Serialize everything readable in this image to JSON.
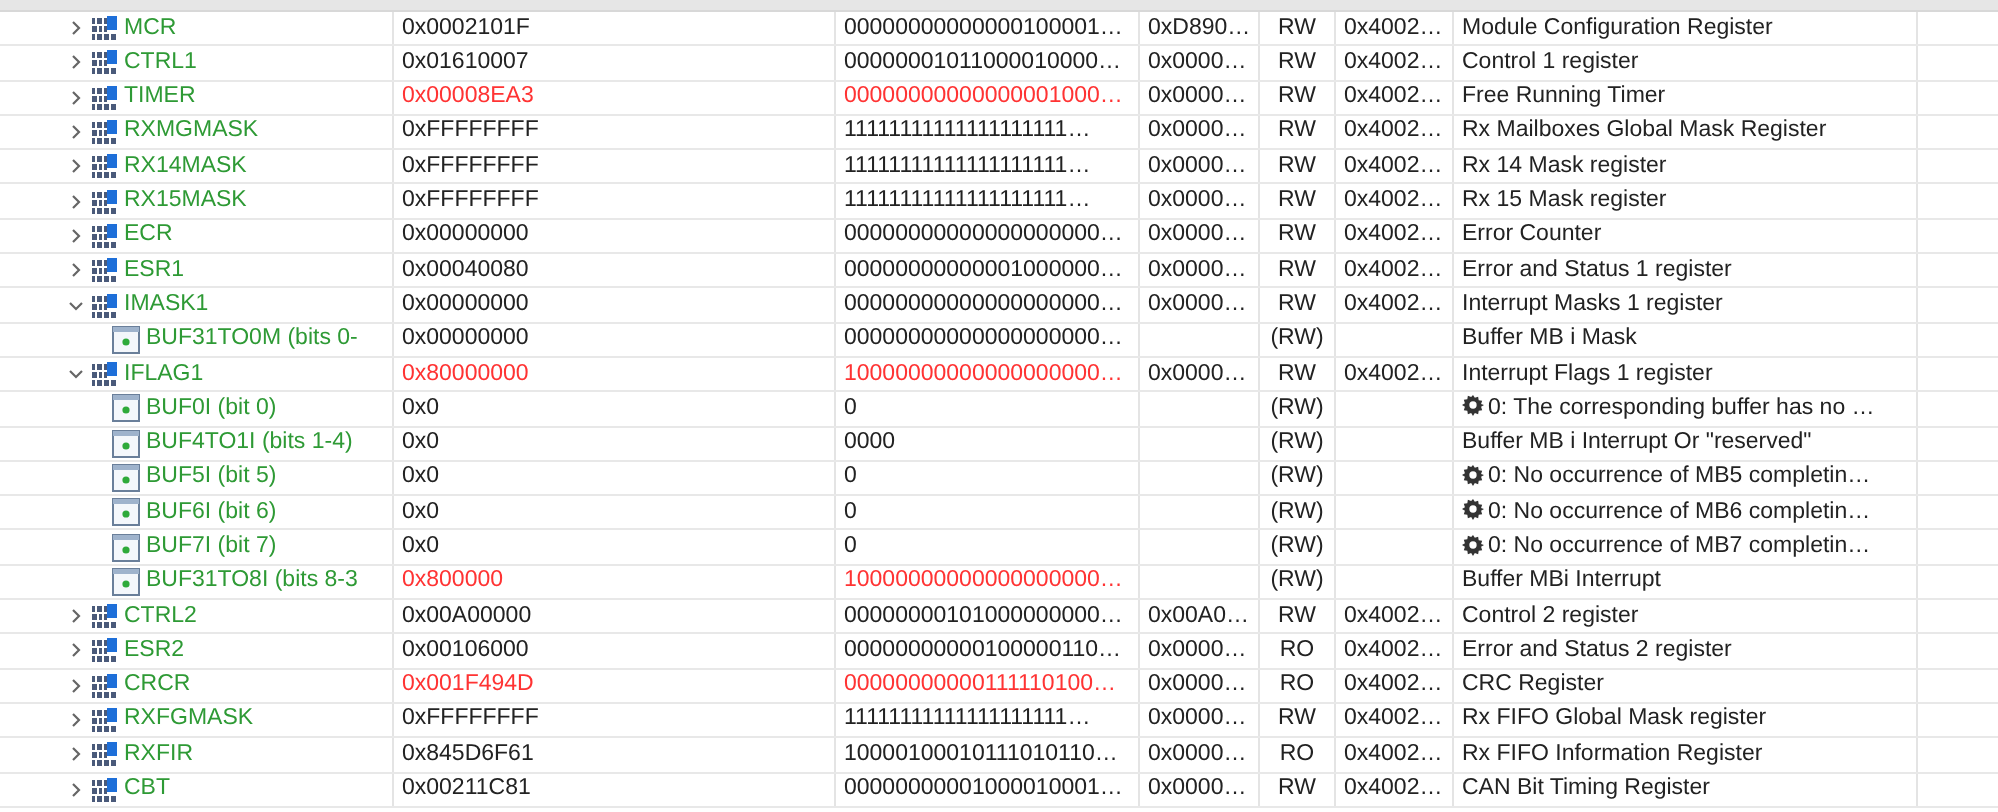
{
  "rows": [
    {
      "name": "MCR",
      "expanded": false,
      "value": "0x0002101F",
      "changed": false,
      "bits": "00000000000000100001…",
      "hex": "0xD890…",
      "access": "RW",
      "address": "0x4002…",
      "description": "Module Configuration Register"
    },
    {
      "name": "CTRL1",
      "expanded": false,
      "value": "0x01610007",
      "changed": false,
      "bits": "00000001011000010000…",
      "hex": "0x0000…",
      "access": "RW",
      "address": "0x4002…",
      "description": "Control 1 register"
    },
    {
      "name": "TIMER",
      "expanded": false,
      "value": "0x00008EA3",
      "changed": true,
      "bits": "00000000000000001000…",
      "hex": "0x0000…",
      "access": "RW",
      "address": "0x4002…",
      "description": "Free Running Timer"
    },
    {
      "name": "RXMGMASK",
      "expanded": false,
      "value": "0xFFFFFFFF",
      "changed": false,
      "bits": "11111111111111111111…",
      "hex": "0x0000…",
      "access": "RW",
      "address": "0x4002…",
      "description": "Rx Mailboxes Global Mask Register"
    },
    {
      "name": "RX14MASK",
      "expanded": false,
      "value": "0xFFFFFFFF",
      "changed": false,
      "bits": "11111111111111111111…",
      "hex": "0x0000…",
      "access": "RW",
      "address": "0x4002…",
      "description": "Rx 14 Mask register"
    },
    {
      "name": "RX15MASK",
      "expanded": false,
      "value": "0xFFFFFFFF",
      "changed": false,
      "bits": "11111111111111111111…",
      "hex": "0x0000…",
      "access": "RW",
      "address": "0x4002…",
      "description": "Rx 15 Mask register"
    },
    {
      "name": "ECR",
      "expanded": false,
      "value": "0x00000000",
      "changed": false,
      "bits": "00000000000000000000…",
      "hex": "0x0000…",
      "access": "RW",
      "address": "0x4002…",
      "description": "Error Counter"
    },
    {
      "name": "ESR1",
      "expanded": false,
      "value": "0x00040080",
      "changed": false,
      "bits": "00000000000001000000…",
      "hex": "0x0000…",
      "access": "RW",
      "address": "0x4002…",
      "description": "Error and Status 1 register"
    },
    {
      "name": "IMASK1",
      "expanded": true,
      "value": "0x00000000",
      "changed": false,
      "bits": "00000000000000000000…",
      "hex": "0x0000…",
      "access": "RW",
      "address": "0x4002…",
      "description": "Interrupt Masks 1 register",
      "children": [
        {
          "name": "BUF31TO0M (bits 0-",
          "value": "0x00000000",
          "changed": false,
          "bits": "00000000000000000000…",
          "access": "(RW)",
          "description": "Buffer MB i Mask",
          "note_icon": false
        }
      ]
    },
    {
      "name": "IFLAG1",
      "expanded": true,
      "value": "0x80000000",
      "changed": true,
      "bits": "10000000000000000000…",
      "hex": "0x0000…",
      "access": "RW",
      "address": "0x4002…",
      "description": "Interrupt Flags 1 register",
      "children": [
        {
          "name": "BUF0I (bit 0)",
          "value": "0x0",
          "changed": false,
          "bits": "0",
          "access": "(RW)",
          "description": "0: The corresponding buffer has no …",
          "note_icon": true
        },
        {
          "name": "BUF4TO1I (bits 1-4)",
          "value": "0x0",
          "changed": false,
          "bits": "0000",
          "access": "(RW)",
          "description": "Buffer MB i Interrupt Or \"reserved\"",
          "note_icon": false
        },
        {
          "name": "BUF5I (bit 5)",
          "value": "0x0",
          "changed": false,
          "bits": "0",
          "access": "(RW)",
          "description": "0: No occurrence of MB5 completin…",
          "note_icon": true
        },
        {
          "name": "BUF6I (bit 6)",
          "value": "0x0",
          "changed": false,
          "bits": "0",
          "access": "(RW)",
          "description": "0: No occurrence of MB6 completin…",
          "note_icon": true
        },
        {
          "name": "BUF7I (bit 7)",
          "value": "0x0",
          "changed": false,
          "bits": "0",
          "access": "(RW)",
          "description": "0: No occurrence of MB7 completin…",
          "note_icon": true
        },
        {
          "name": "BUF31TO8I (bits 8-3",
          "value": "0x800000",
          "changed": true,
          "bits": "10000000000000000000…",
          "access": "(RW)",
          "description": "Buffer MBi Interrupt",
          "note_icon": false
        }
      ]
    },
    {
      "name": "CTRL2",
      "expanded": false,
      "value": "0x00A00000",
      "changed": false,
      "bits": "00000000101000000000…",
      "hex": "0x00A0…",
      "access": "RW",
      "address": "0x4002…",
      "description": "Control 2 register"
    },
    {
      "name": "ESR2",
      "expanded": false,
      "value": "0x00106000",
      "changed": false,
      "bits": "00000000000100000110…",
      "hex": "0x0000…",
      "access": "RO",
      "address": "0x4002…",
      "description": "Error and Status 2 register"
    },
    {
      "name": "CRCR",
      "expanded": false,
      "value": "0x001F494D",
      "changed": true,
      "bits": "00000000000111110100…",
      "hex": "0x0000…",
      "access": "RO",
      "address": "0x4002…",
      "description": "CRC Register"
    },
    {
      "name": "RXFGMASK",
      "expanded": false,
      "value": "0xFFFFFFFF",
      "changed": false,
      "bits": "11111111111111111111…",
      "hex": "0x0000…",
      "access": "RW",
      "address": "0x4002…",
      "description": "Rx FIFO Global Mask register"
    },
    {
      "name": "RXFIR",
      "expanded": false,
      "value": "0x845D6F61",
      "changed": false,
      "bits": "10000100010111010110…",
      "hex": "0x0000…",
      "access": "RO",
      "address": "0x4002…",
      "description": "Rx FIFO Information Register"
    },
    {
      "name": "CBT",
      "expanded": false,
      "value": "0x00211C81",
      "changed": false,
      "bits": "00000000001000010001…",
      "hex": "0x0000…",
      "access": "RW",
      "address": "0x4002…",
      "description": "CAN Bit Timing Register"
    }
  ]
}
